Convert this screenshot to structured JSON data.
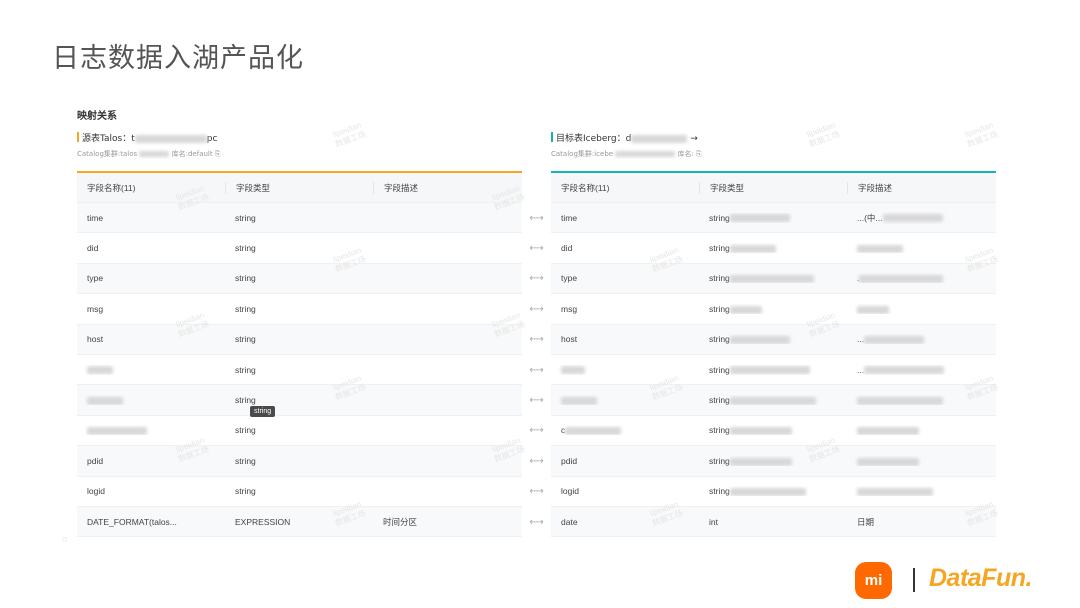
{
  "slide": {
    "title": "日志数据入湖产品化"
  },
  "section": {
    "title": "映射关系"
  },
  "source": {
    "label": "源表Talos：",
    "prefix": "t",
    "suffix": "pc",
    "meta_catalog": "Catalog集群:talos",
    "meta_db": "库名:default"
  },
  "target": {
    "label": "目标表Iceberg：",
    "prefix": "d",
    "suffix": "→",
    "meta_catalog": "Catalog集群:icebe",
    "meta_db": "库名:"
  },
  "left_table": {
    "headers": [
      "字段名称(11)",
      "字段类型",
      "字段描述"
    ],
    "rows": [
      [
        "time",
        "string",
        ""
      ],
      [
        "did",
        "string",
        ""
      ],
      [
        "type",
        "string",
        ""
      ],
      [
        "msg",
        "string",
        ""
      ],
      [
        "host",
        "string",
        ""
      ],
      [
        "",
        "string",
        ""
      ],
      [
        "",
        "string",
        ""
      ],
      [
        "",
        "string",
        ""
      ],
      [
        "pdid",
        "string",
        ""
      ],
      [
        "logid",
        "string",
        ""
      ],
      [
        "DATE_FORMAT(talos...",
        "EXPRESSION",
        "时间分区"
      ]
    ]
  },
  "right_table": {
    "headers": [
      "字段名称(11)",
      "字段类型",
      "字段描述"
    ],
    "rows": [
      [
        "time",
        "string",
        "...(中..."
      ],
      [
        "did",
        "string",
        ""
      ],
      [
        "type",
        "string",
        "."
      ],
      [
        "msg",
        "string",
        ""
      ],
      [
        "host",
        "string",
        "..."
      ],
      [
        "",
        "string",
        "..."
      ],
      [
        "",
        "string",
        ""
      ],
      [
        "c",
        "string",
        ""
      ],
      [
        "pdid",
        "string",
        ""
      ],
      [
        "logid",
        "string",
        ""
      ],
      [
        "date",
        "int",
        "日期"
      ]
    ]
  },
  "arrow_glyph": "⟷",
  "tooltip": {
    "text": "string"
  },
  "watermark": {
    "line1": "lipeidian",
    "line2": "数据工场"
  },
  "logos": {
    "mi": "mi",
    "datafun": "DataFun."
  }
}
